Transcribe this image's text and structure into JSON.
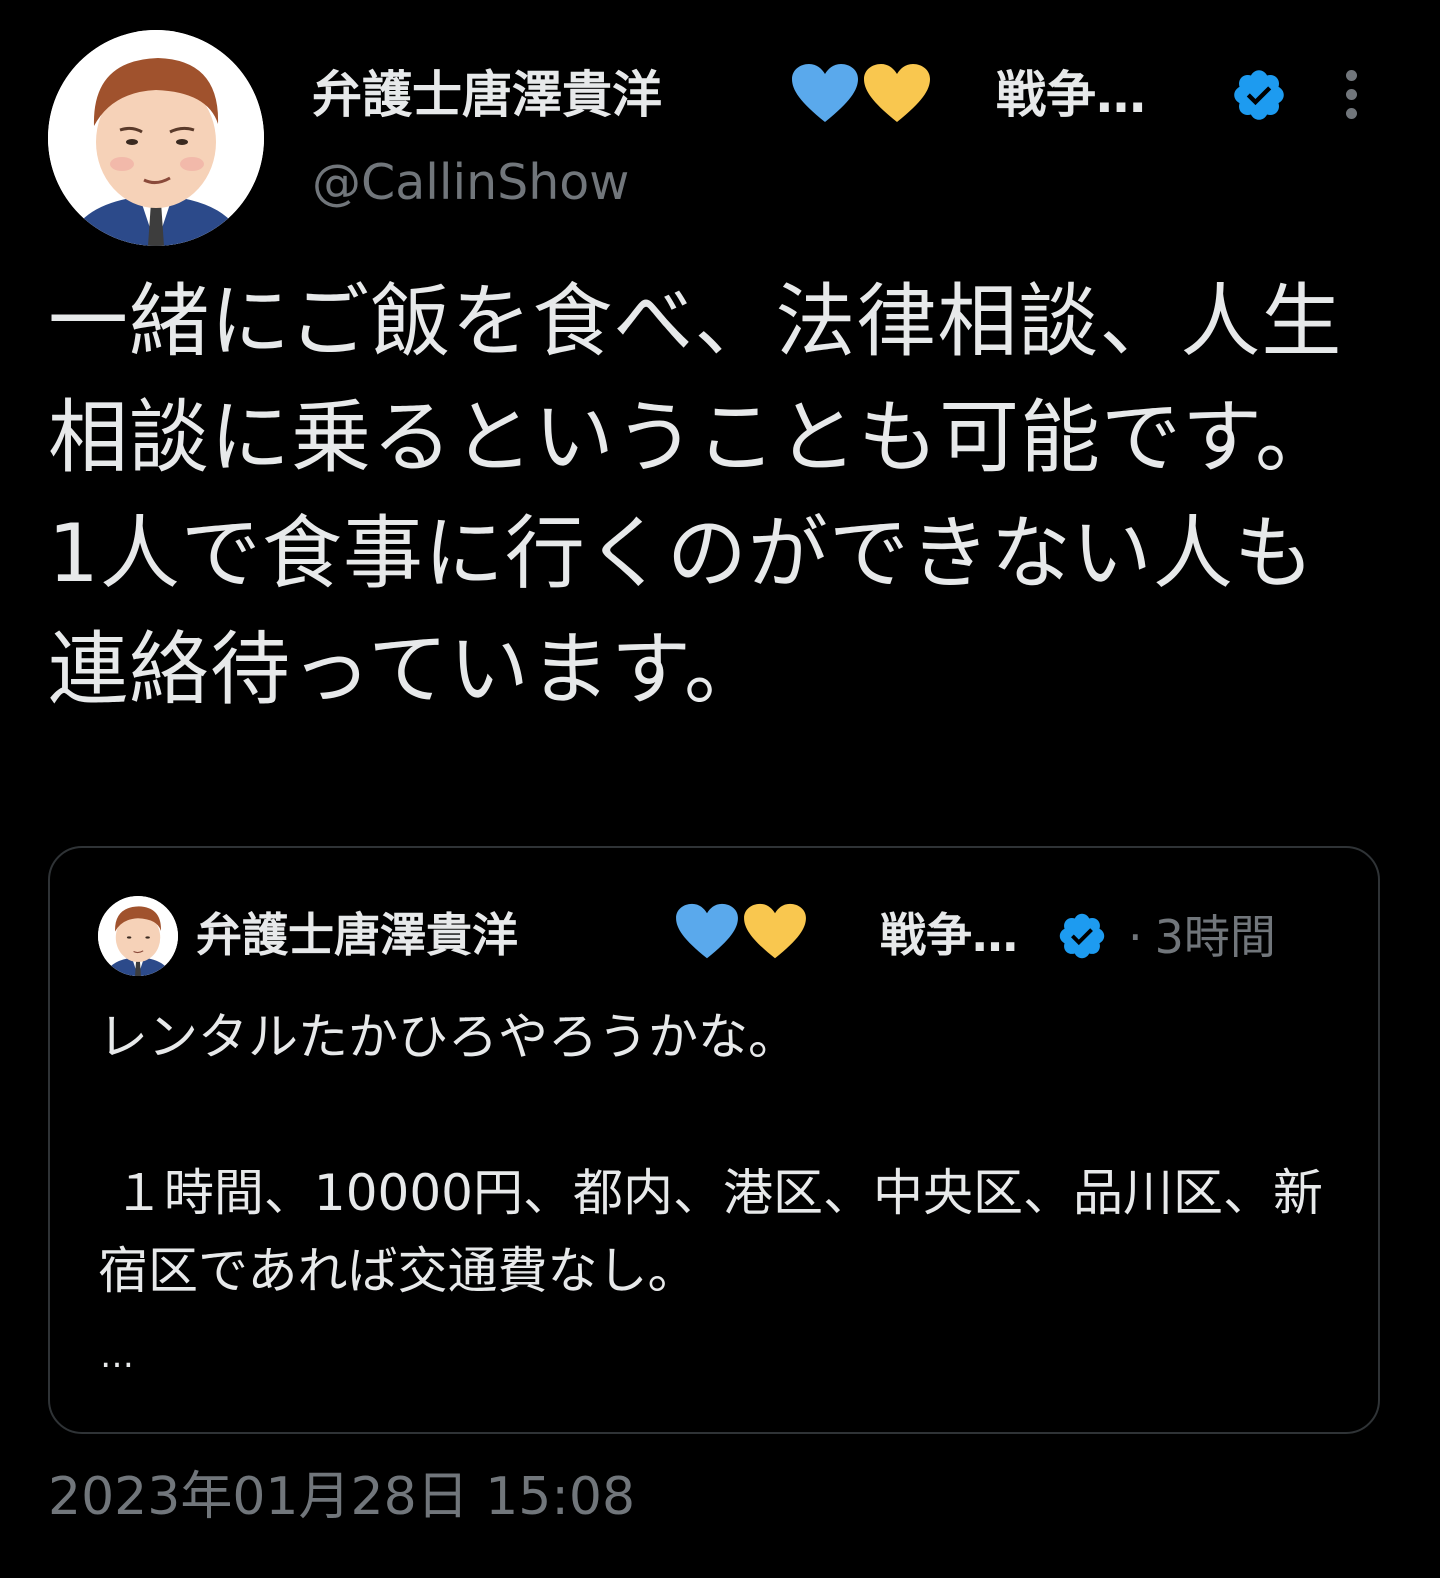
{
  "tweet": {
    "display_name": "弁護士唐澤貴洋",
    "name_suffix": "戦争…",
    "hearts": [
      "blue-heart",
      "yellow-heart"
    ],
    "handle": "@CallinShow",
    "text": "一緒にご飯を食べ、法律相談、人生相談に乗るということも可能です。\n1人で食事に行くのができない人も連絡待っています。",
    "timestamp": "2023年01月28日 15:08"
  },
  "quoted_tweet": {
    "display_name": "弁護士唐澤貴洋",
    "name_suffix": "戦争…",
    "separator": "·",
    "time": "3時間",
    "text": "レンタルたかひろやろうかな。\n\n １時間、10000円、都内、港区、中央区、品川区、新宿区であれば交通費なし。",
    "ellipsis": "…"
  },
  "colors": {
    "background": "#000000",
    "text": "#e7e9ea",
    "secondary": "#71767b",
    "verified": "#1d9bf0",
    "blue_heart": "#5aa9ec",
    "yellow_heart": "#f9c74f",
    "border": "#2f3336"
  }
}
